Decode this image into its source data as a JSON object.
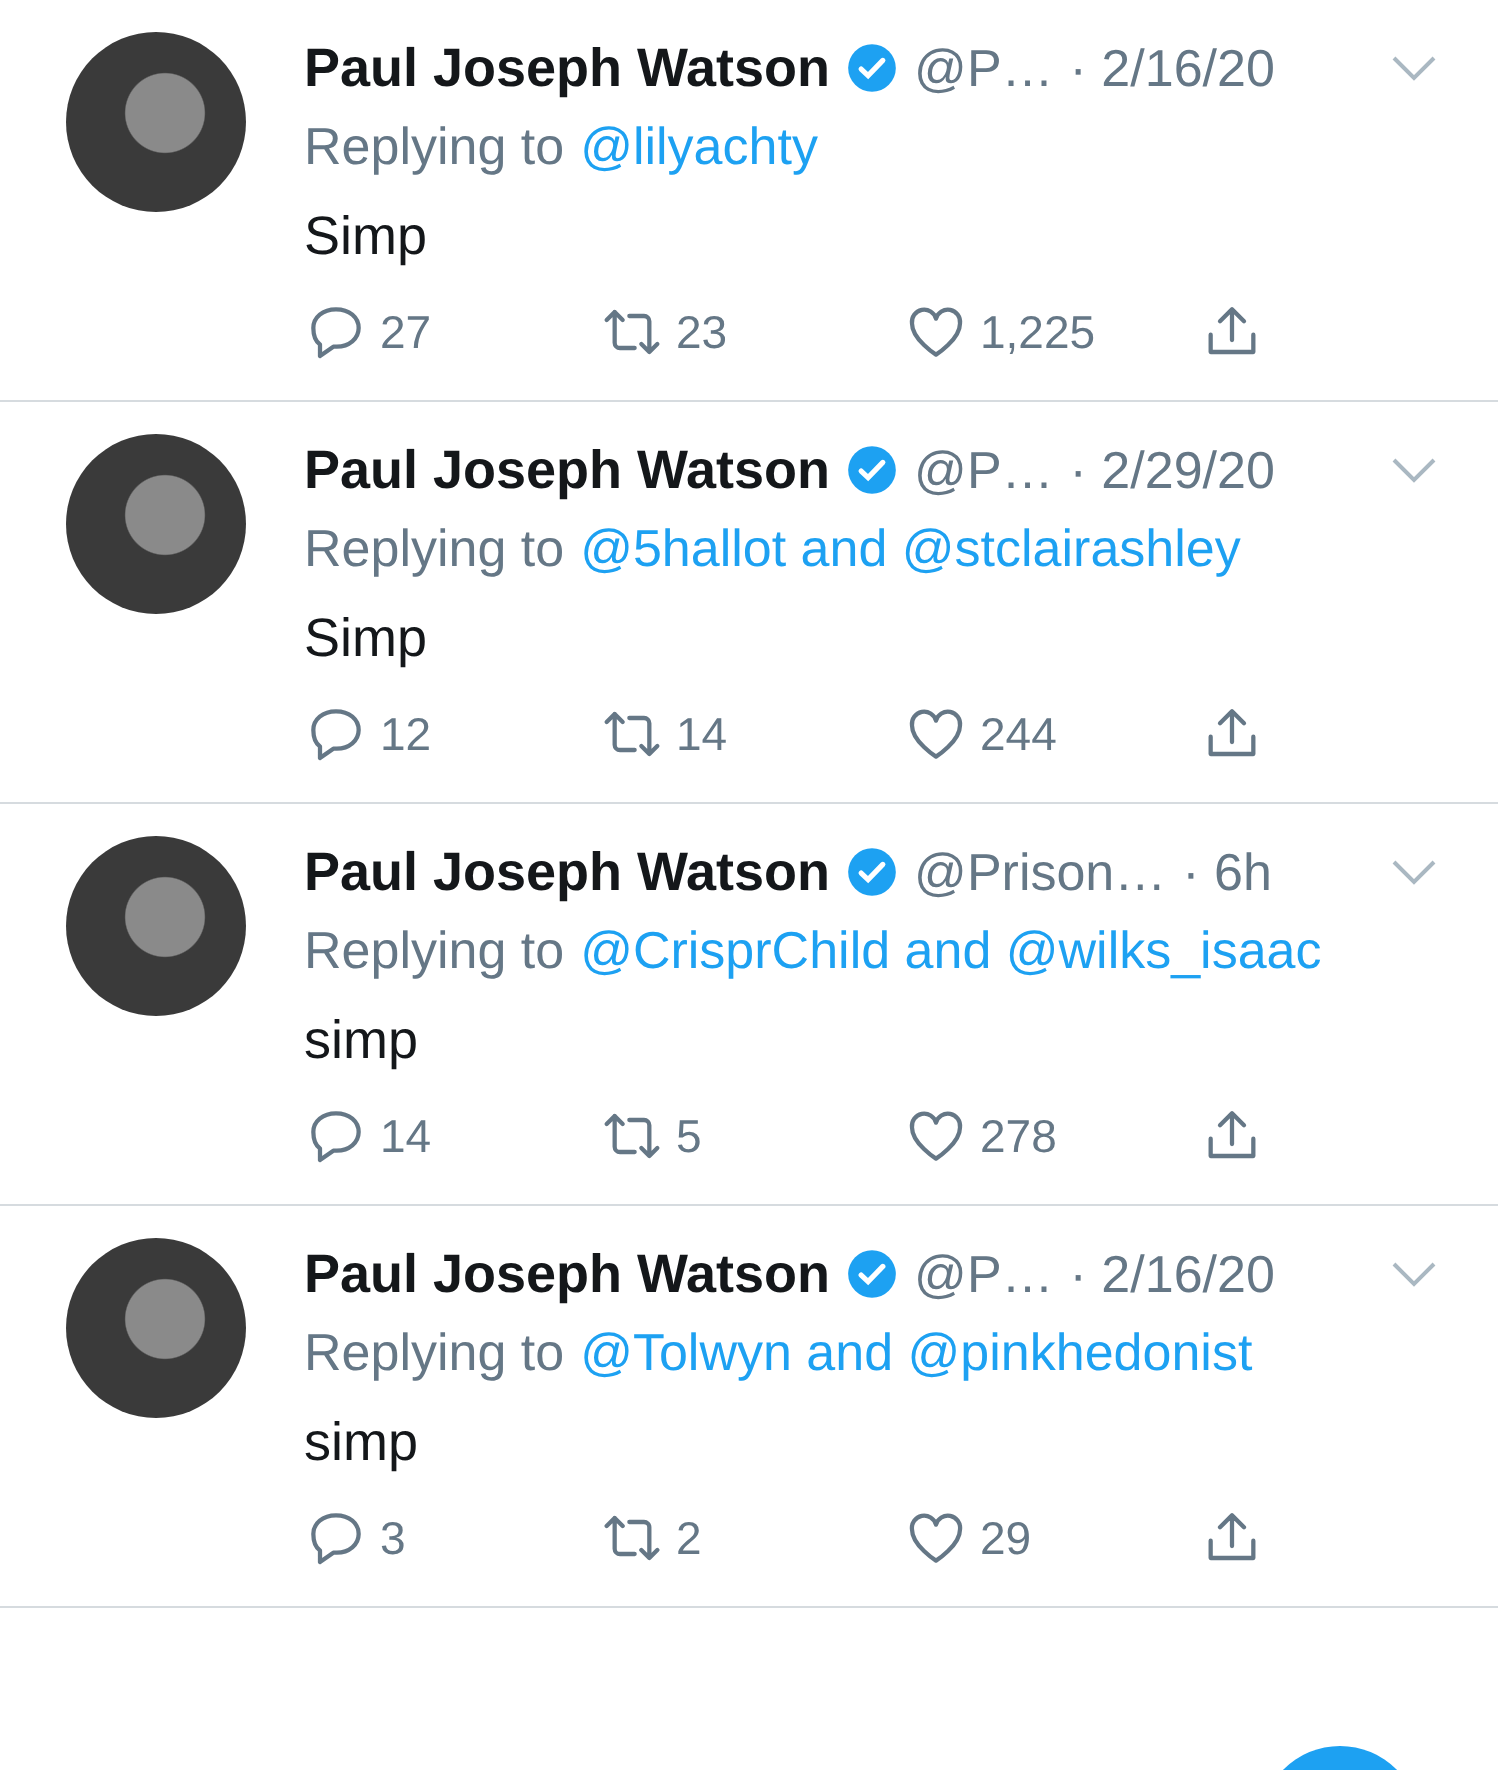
{
  "tweets": [
    {
      "name": "Paul Joseph Watson",
      "verified": true,
      "handle": "@P…",
      "time": "· 2/16/20",
      "replying_label": "Replying to",
      "reply_to": "@lilyachty",
      "text": "Simp",
      "replies": "27",
      "retweets": "23",
      "likes": "1,225"
    },
    {
      "name": "Paul Joseph Watson",
      "verified": true,
      "handle": "@P…",
      "time": "· 2/29/20",
      "replying_label": "Replying to",
      "reply_to": "@5hallot and @stclairashley",
      "text": "Simp",
      "replies": "12",
      "retweets": "14",
      "likes": "244"
    },
    {
      "name": "Paul Joseph Watson",
      "verified": true,
      "handle": "@Prison…",
      "time": "· 6h",
      "replying_label": "Replying to",
      "reply_to": "@CrisprChild and @wilks_isaac",
      "text": "simp",
      "replies": "14",
      "retweets": "5",
      "likes": "278"
    },
    {
      "name": "Paul Joseph Watson",
      "verified": true,
      "handle": "@P…",
      "time": "· 2/16/20",
      "replying_label": "Replying to",
      "reply_to": "@Tolwyn and @pinkhedonist",
      "text": "simp",
      "replies": "3",
      "retweets": "2",
      "likes": "29"
    }
  ]
}
